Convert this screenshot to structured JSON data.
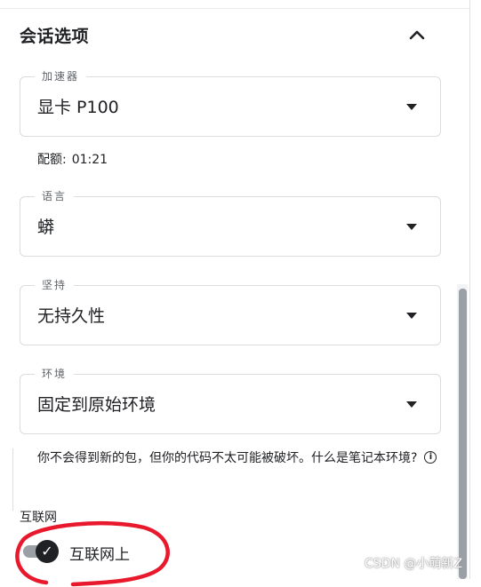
{
  "section": {
    "title": "会话选项",
    "collapse_icon": "chevron-up-icon"
  },
  "accelerator": {
    "label": "加速器",
    "value": "显卡 P100"
  },
  "quota": {
    "label": "配额:",
    "value": "01:21"
  },
  "language": {
    "label": "语言",
    "value": "蟒"
  },
  "persistence": {
    "label": "坚持",
    "value": "无持久性"
  },
  "environment": {
    "label": "环境",
    "value": "固定到原始环境"
  },
  "note": {
    "text": "你不会得到新的包，但你的代码不太可能被破坏。什么是笔记本环境?",
    "info_icon": "info-icon"
  },
  "internet": {
    "heading": "互联网",
    "toggle_label": "互联网上",
    "toggle_on": true
  },
  "watermark": "CSDN @小萌新Z",
  "colors": {
    "annotation_red": "#e8192c",
    "toggle_knob": "#202124",
    "toggle_track": "#9aa0a6",
    "border": "#dadce0"
  }
}
